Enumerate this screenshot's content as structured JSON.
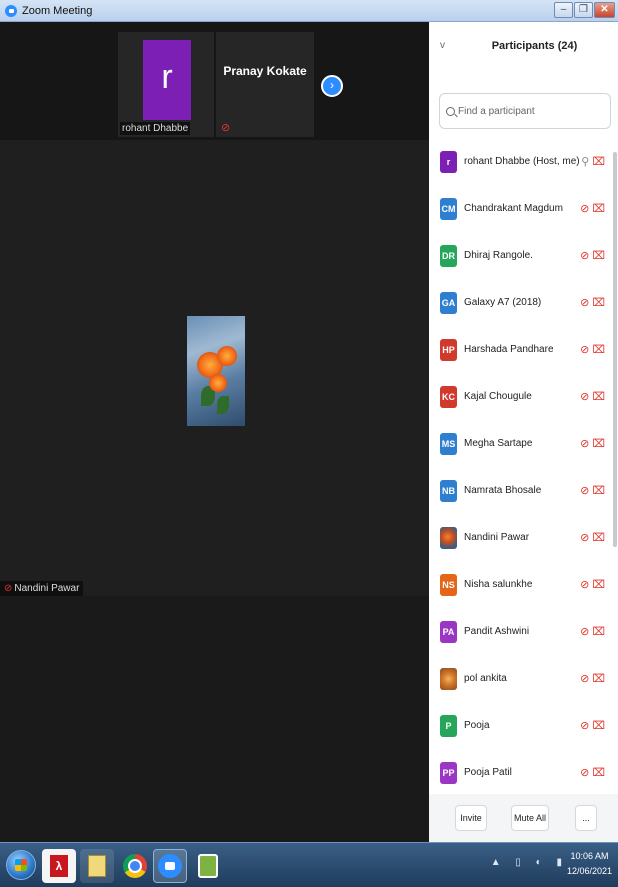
{
  "window": {
    "title": "Zoom Meeting",
    "min": "–",
    "max": "❐",
    "close": "✕"
  },
  "video": {
    "thumbs": [
      {
        "avatar_letter": "r",
        "name": "rohant Dhabbe"
      },
      {
        "name": "Pranay Kokate"
      }
    ],
    "next_icon": "›",
    "active_speaker": "Nandini Pawar",
    "muted_icon": "🎤"
  },
  "panel": {
    "collapse_icon": "v",
    "title": "Participants (24)",
    "search_placeholder": "Find a participant",
    "participants": [
      {
        "initials": "r",
        "name": "rohant Dhabbe (Host, me)",
        "color": "#7c1fb4"
      },
      {
        "initials": "CM",
        "name": "Chandrakant Magdum",
        "color": "#2f7fd0"
      },
      {
        "initials": "DR",
        "name": "Dhiraj Rangole.",
        "color": "#26a65b"
      },
      {
        "initials": "GA",
        "name": "Galaxy A7 (2018)",
        "color": "#2f7fd0"
      },
      {
        "initials": "HP",
        "name": "Harshada  Pandhare",
        "color": "#d0392b"
      },
      {
        "initials": "KC",
        "name": "Kajal Chougule",
        "color": "#d0392b"
      },
      {
        "initials": "MS",
        "name": "Megha Sartape",
        "color": "#2f7fd0"
      },
      {
        "initials": "NB",
        "name": "Namrata Bhosale",
        "color": "#2f7fd0"
      },
      {
        "initials": "",
        "name": "Nandini Pawar",
        "color": "photo"
      },
      {
        "initials": "NS",
        "name": "Nisha salunkhe",
        "color": "#e5651a"
      },
      {
        "initials": "PA",
        "name": "Pandit Ashwini",
        "color": "#9b35c4"
      },
      {
        "initials": "",
        "name": "pol ankita",
        "color": "photo"
      },
      {
        "initials": "P",
        "name": "Pooja",
        "color": "#26a65b"
      },
      {
        "initials": "PP",
        "name": "Pooja Patil",
        "color": "#9b35c4"
      }
    ],
    "footer": {
      "invite": "Invite",
      "mute_all": "Mute All",
      "more": "..."
    }
  },
  "taskbar": {
    "time": "10:06 AM",
    "date": "12/06/2021",
    "tray_icons": "▲ ▯ ◐ ▮"
  }
}
